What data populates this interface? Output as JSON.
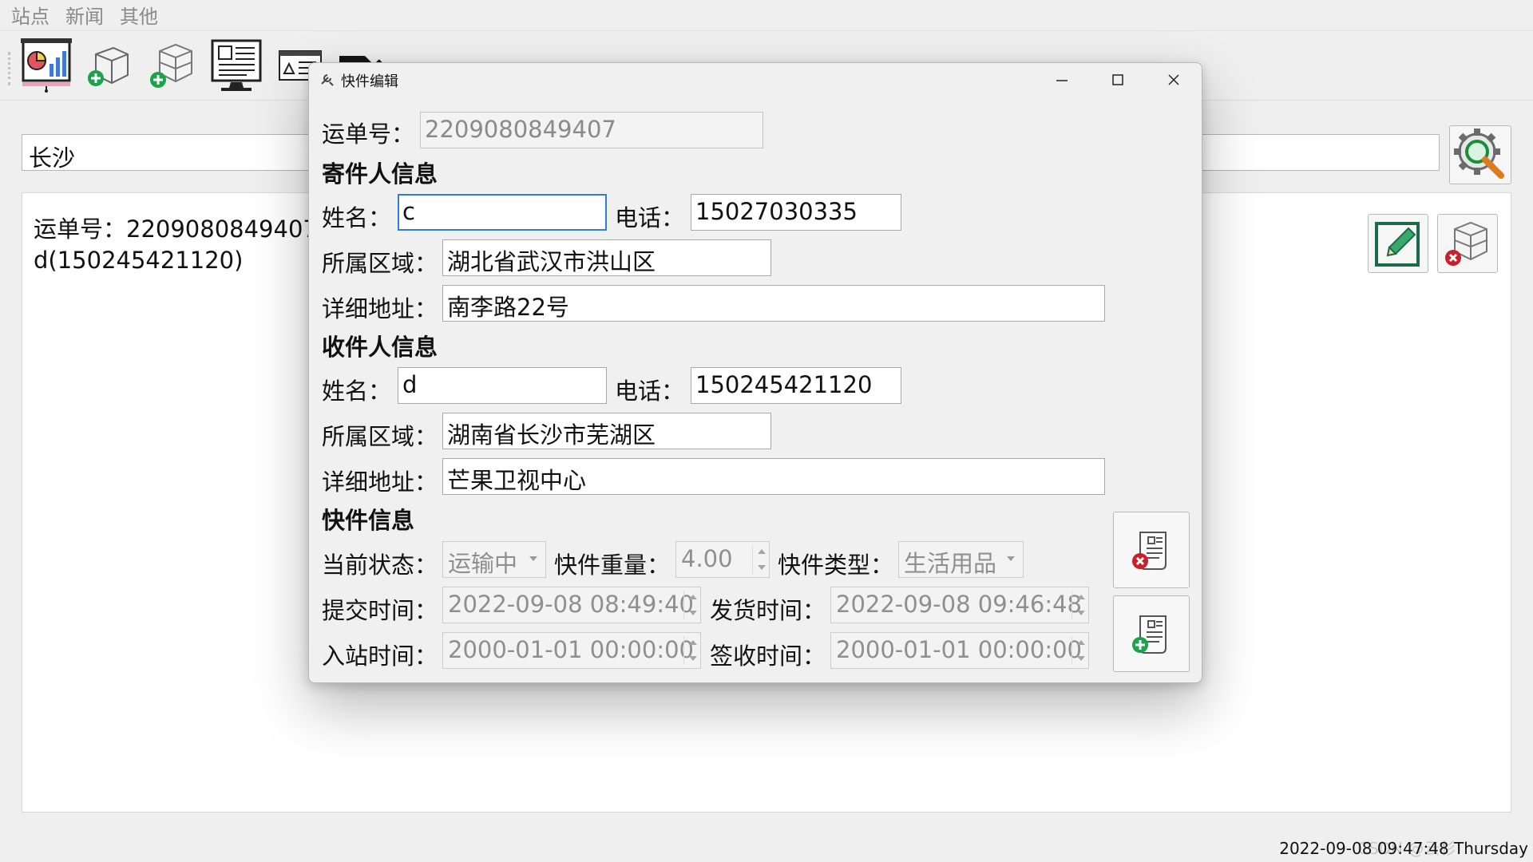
{
  "menu": [
    "站点",
    "新闻",
    "其他"
  ],
  "toolbar": [
    {
      "icon": "chart-board-icon"
    },
    {
      "icon": "add-package-icon"
    },
    {
      "icon": "add-box-icon"
    },
    {
      "icon": "news-monitor-icon"
    },
    {
      "icon": "id-card-icon"
    },
    {
      "icon": "export-icon"
    }
  ],
  "search": {
    "value": "长沙",
    "button_icon": "gear-search-icon"
  },
  "results": [
    {
      "line1": "运单号：2209080849407",
      "line2": "d(150245421120)"
    }
  ],
  "card_actions": [
    {
      "icon": "edit-icon"
    },
    {
      "icon": "delete-box-icon"
    }
  ],
  "statusbar": {
    "datetime": "2022-09-08 09:47:48 Thursday"
  },
  "watermark": "CSDN @云杉",
  "dialog": {
    "title": "快件编辑",
    "waybill_label": "运单号：",
    "waybill_no": "2209080849407",
    "sender_heading": "寄件人信息",
    "receiver_heading": "收件人信息",
    "parcel_heading": "快件信息",
    "labels": {
      "name": "姓名：",
      "phone": "电话：",
      "region": "所属区域：",
      "address": "详细地址：",
      "status": "当前状态：",
      "weight": "快件重量：",
      "type": "快件类型：",
      "submit_time": "提交时间：",
      "ship_time": "发货时间：",
      "arrive_time": "入站时间：",
      "sign_time": "签收时间："
    },
    "sender": {
      "name": "c",
      "phone": "15027030335",
      "region": "湖北省武汉市洪山区",
      "address": "南李路22号"
    },
    "receiver": {
      "name": "d",
      "phone": "150245421120",
      "region": "湖南省长沙市芜湖区",
      "address": "芒果卫视中心"
    },
    "parcel": {
      "status": "运输中",
      "weight": "4.00",
      "type": "生活用品",
      "submit_time": "2022-09-08 08:49:40",
      "ship_time": "2022-09-08 09:46:48",
      "arrive_time": "2000-01-01 00:00:00",
      "sign_time": "2000-01-01 00:00:00"
    },
    "side_buttons": [
      {
        "icon": "delete-order-icon"
      },
      {
        "icon": "add-order-icon"
      }
    ]
  },
  "colors": {
    "accent": "#2c7de0",
    "green": "#1aa34a",
    "red": "#c8202c"
  }
}
